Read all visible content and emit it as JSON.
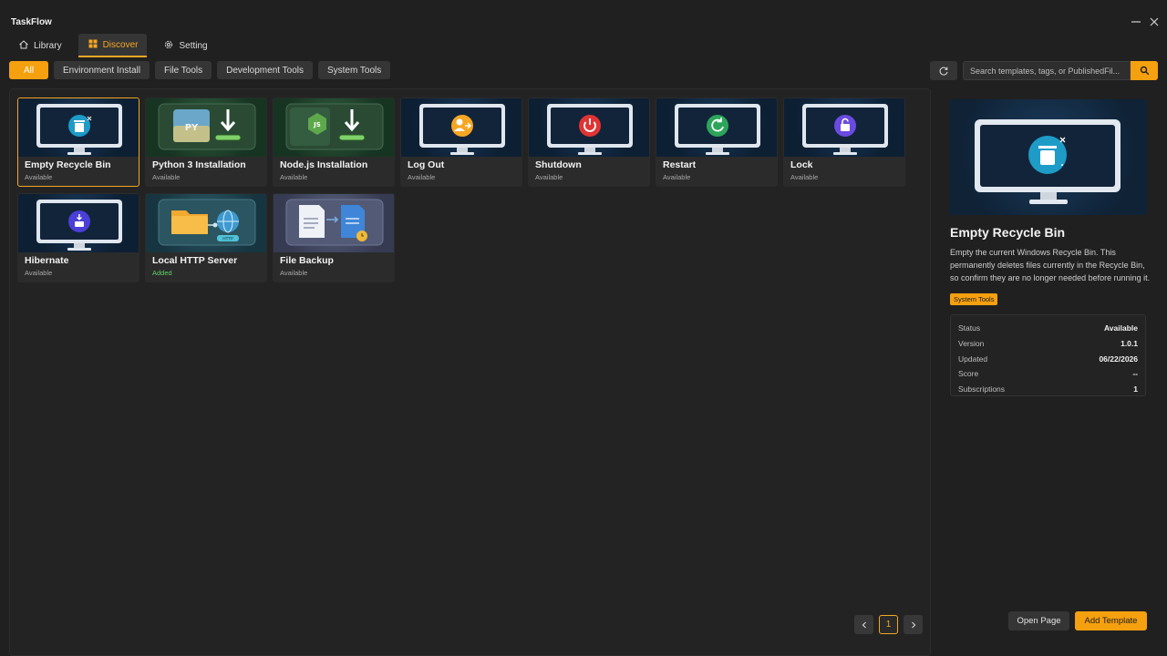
{
  "app": {
    "title": "TaskFlow"
  },
  "window": {
    "minimize_icon": "minimize-icon",
    "close_icon": "close-icon"
  },
  "nav": {
    "tabs": [
      {
        "label": "Library",
        "icon": "home-icon"
      },
      {
        "label": "Discover",
        "icon": "grid-icon",
        "active": true
      },
      {
        "label": "Setting",
        "icon": "gear-icon"
      }
    ]
  },
  "filters": [
    "All",
    "Environment Install",
    "File Tools",
    "Development Tools",
    "System Tools"
  ],
  "search": {
    "placeholder": "Search templates, tags, or PublishedFil..."
  },
  "templates": [
    {
      "title": "Empty Recycle Bin",
      "status": "Available",
      "icon": "recycle-bin-icon"
    },
    {
      "title": "Python 3 Installation",
      "status": "Available",
      "icon": "python-install-icon"
    },
    {
      "title": "Node.js Installation",
      "status": "Available",
      "icon": "nodejs-install-icon"
    },
    {
      "title": "Log Out",
      "status": "Available",
      "icon": "logout-icon"
    },
    {
      "title": "Shutdown",
      "status": "Available",
      "icon": "power-icon"
    },
    {
      "title": "Restart",
      "status": "Available",
      "icon": "restart-icon"
    },
    {
      "title": "Lock",
      "status": "Available",
      "icon": "lock-icon"
    },
    {
      "title": "Hibernate",
      "status": "Available",
      "icon": "hibernate-icon"
    },
    {
      "title": "Local HTTP Server",
      "status": "Added",
      "icon": "http-server-icon"
    },
    {
      "title": "File Backup",
      "status": "Available",
      "icon": "file-backup-icon"
    }
  ],
  "thumb_labels": {
    "python": "PY",
    "node": "JS",
    "http": "HTTP"
  },
  "pagination": {
    "current": "1"
  },
  "detail": {
    "title": "Empty Recycle Bin",
    "description": "Empty the current Windows Recycle Bin. This permanently deletes files currently in the Recycle Bin, so confirm they are no longer needed before running it.",
    "tag": "System Tools",
    "info": [
      {
        "key": "Status",
        "value": "Available"
      },
      {
        "key": "Version",
        "value": "1.0.1"
      },
      {
        "key": "Updated",
        "value": "06/22/2026"
      },
      {
        "key": "Score",
        "value": "--"
      },
      {
        "key": "Subscriptions",
        "value": "1"
      }
    ],
    "open_label": "Open Page",
    "add_label": "Add Template"
  },
  "colors": {
    "accent": "#f5a00f",
    "added": "#5fcf6a",
    "background": "#202020"
  }
}
